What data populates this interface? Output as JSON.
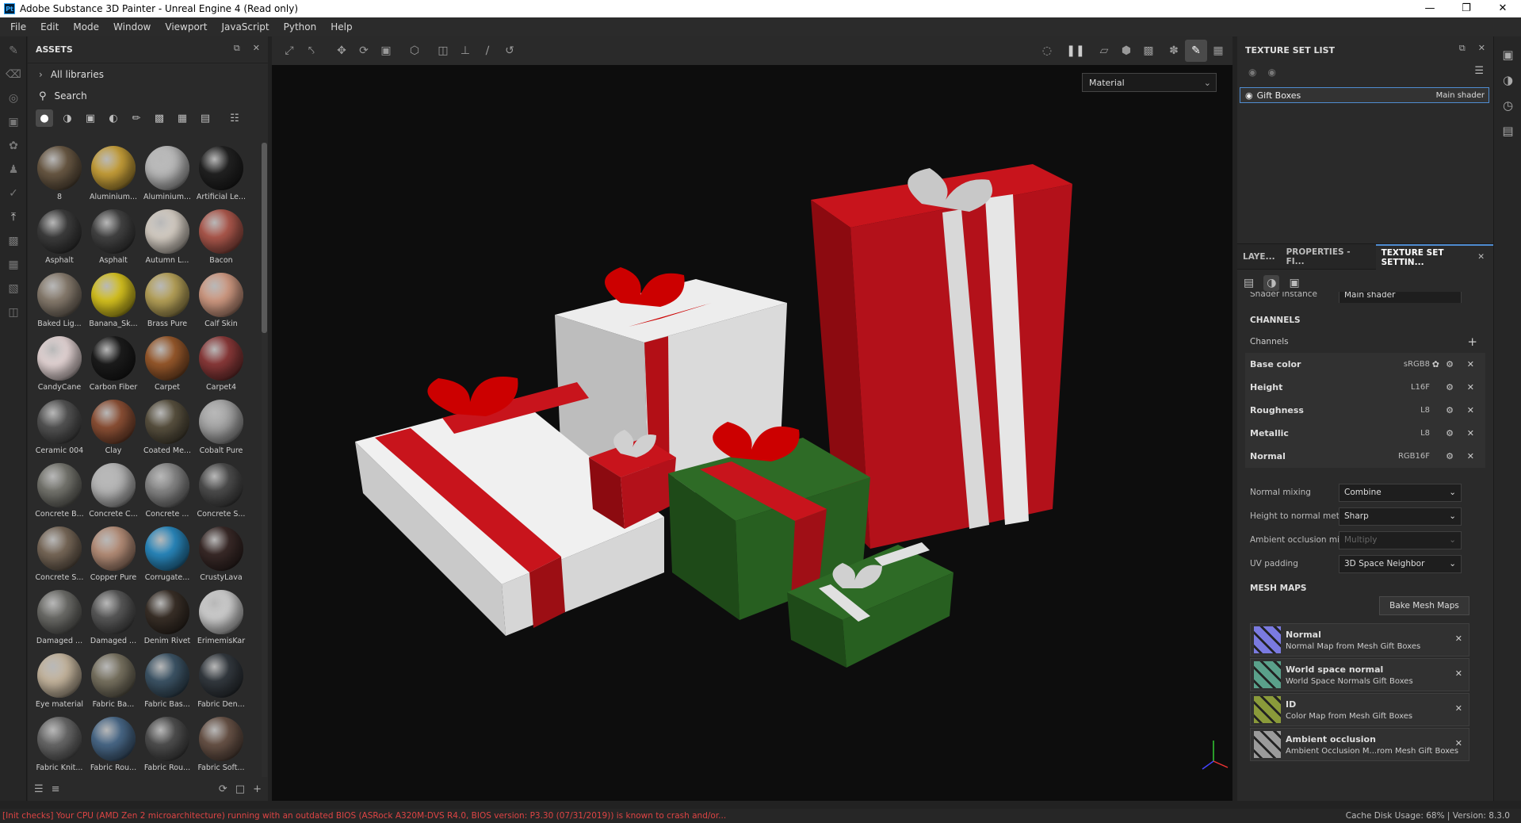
{
  "window": {
    "title": "Adobe Substance 3D Painter - Unreal Engine 4 (Read only)",
    "app_icon": "Pt"
  },
  "menu": [
    "File",
    "Edit",
    "Mode",
    "Window",
    "Viewport",
    "JavaScript",
    "Python",
    "Help"
  ],
  "assets": {
    "title": "ASSETS",
    "all_libraries": "All libraries",
    "search_placeholder": "Search",
    "items": [
      {
        "label": "8",
        "color": "#6b5a45"
      },
      {
        "label": "Aluminium...",
        "color": "#c9a13a"
      },
      {
        "label": "Aluminium...",
        "color": "#bcbcbc"
      },
      {
        "label": "Artificial Le...",
        "color": "#222222"
      },
      {
        "label": "Asphalt",
        "color": "#3e3e3e"
      },
      {
        "label": "Asphalt",
        "color": "#444444"
      },
      {
        "label": "Autumn L...",
        "color": "#d8d0c6"
      },
      {
        "label": "Bacon",
        "color": "#b05a4e"
      },
      {
        "label": "Baked Lig...",
        "color": "#8a7e70"
      },
      {
        "label": "Banana_Sk...",
        "color": "#d9c520"
      },
      {
        "label": "Brass Pure",
        "color": "#b9a45a"
      },
      {
        "label": "Calf Skin",
        "color": "#d39c84"
      },
      {
        "label": "CandyCane",
        "color": "#e8d8d8"
      },
      {
        "label": "Carbon Fiber",
        "color": "#1c1c1c"
      },
      {
        "label": "Carpet",
        "color": "#9a5a2c"
      },
      {
        "label": "Carpet4",
        "color": "#8c3a3a"
      },
      {
        "label": "Ceramic 004",
        "color": "#555555"
      },
      {
        "label": "Clay",
        "color": "#8e5136"
      },
      {
        "label": "Coated Me...",
        "color": "#5a5240"
      },
      {
        "label": "Cobalt Pure",
        "color": "#a8a8a8"
      },
      {
        "label": "Concrete B...",
        "color": "#777770"
      },
      {
        "label": "Concrete C...",
        "color": "#b8b8b8"
      },
      {
        "label": "Concrete ...",
        "color": "#888888"
      },
      {
        "label": "Concrete S...",
        "color": "#4e4e4e"
      },
      {
        "label": "Concrete S...",
        "color": "#7a6a5a"
      },
      {
        "label": "Copper Pure",
        "color": "#b8907a"
      },
      {
        "label": "Corrugate...",
        "color": "#2a8ac0"
      },
      {
        "label": "CrustyLava",
        "color": "#3a2a28"
      },
      {
        "label": "Damaged ...",
        "color": "#6e6e6a"
      },
      {
        "label": "Damaged ...",
        "color": "#5a5a5a"
      },
      {
        "label": "Denim Rivet",
        "color": "#3a3028"
      },
      {
        "label": "ErimemisKar",
        "color": "#d0d0d0"
      },
      {
        "label": "Eye material",
        "color": "#c8b8a0"
      },
      {
        "label": "Fabric Ba...",
        "color": "#7a7462"
      },
      {
        "label": "Fabric Bas...",
        "color": "#3e5668"
      },
      {
        "label": "Fabric Den...",
        "color": "#343a40"
      },
      {
        "label": "Fabric Knit...",
        "color": "#6a6a6a"
      },
      {
        "label": "Fabric Rou...",
        "color": "#4a6a8a"
      },
      {
        "label": "Fabric Rou...",
        "color": "#505050"
      },
      {
        "label": "Fabric Soft...",
        "color": "#6a5448"
      }
    ]
  },
  "viewport": {
    "material_select": "Material"
  },
  "texture_set_list": {
    "title": "TEXTURE SET LIST",
    "row_name": "Gift Boxes",
    "row_shader": "Main shader"
  },
  "tabs": [
    "LAYE...",
    "PROPERTIES - FI...",
    "TEXTURE SET SETTIN..."
  ],
  "settings": {
    "shader_instance_label": "Shader instance",
    "shader_instance_value": "Main shader",
    "channels_header": "CHANNELS",
    "channels_label": "Channels",
    "channels": [
      {
        "name": "Base color",
        "format": "sRGB8"
      },
      {
        "name": "Height",
        "format": "L16F"
      },
      {
        "name": "Roughness",
        "format": "L8"
      },
      {
        "name": "Metallic",
        "format": "L8"
      },
      {
        "name": "Normal",
        "format": "RGB16F"
      }
    ],
    "props": [
      {
        "label": "Normal mixing",
        "value": "Combine",
        "disabled": false
      },
      {
        "label": "Height to normal method",
        "value": "Sharp",
        "disabled": false
      },
      {
        "label": "Ambient occlusion mixing",
        "value": "Multiply",
        "disabled": true
      },
      {
        "label": "UV padding",
        "value": "3D Space Neighbor",
        "disabled": false
      }
    ],
    "mesh_maps_header": "MESH MAPS",
    "bake_button": "Bake Mesh Maps",
    "mesh_maps": [
      {
        "title": "Normal",
        "desc": "Normal Map from Mesh Gift Boxes",
        "color": "#7a7ae0"
      },
      {
        "title": "World space normal",
        "desc": "World Space Normals Gift Boxes",
        "color": "#5aa08a"
      },
      {
        "title": "ID",
        "desc": "Color Map from Mesh Gift Boxes",
        "color": "#8a9a3a"
      },
      {
        "title": "Ambient occlusion",
        "desc": "Ambient Occlusion M...rom Mesh Gift Boxes",
        "color": "#9a9a9a"
      }
    ]
  },
  "status": {
    "error": "[Init checks] Your CPU (AMD Zen 2 microarchitecture) running with an outdated BIOS (ASRock A320M-DVS R4.0, BIOS version: P3.30 (07/31/2019)) is known to crash and/or...",
    "cache": "Cache Disk Usage:   68%  |  Version: 8.3.0"
  }
}
